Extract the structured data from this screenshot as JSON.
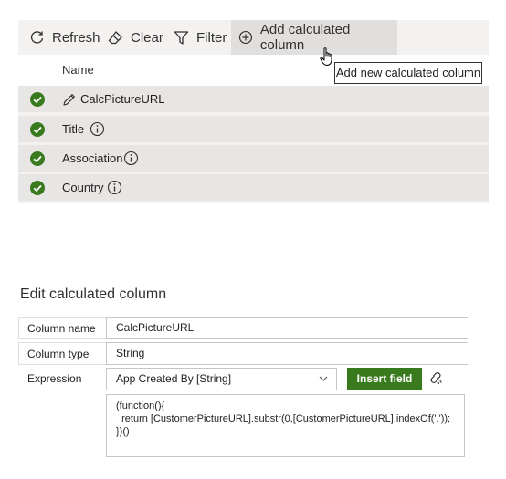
{
  "toolbar": {
    "refresh_label": "Refresh",
    "clear_label": "Clear",
    "filter_label": "Filter",
    "add_calc_label": "Add calculated column"
  },
  "tooltip": {
    "text": "Add new calculated column"
  },
  "list": {
    "header": "Name",
    "rows": [
      {
        "label": "CalcPictureURL",
        "icon": "pencil-icon",
        "info": false
      },
      {
        "label": "Title",
        "icon": "",
        "info": true
      },
      {
        "label": "Association",
        "icon": "",
        "info": true
      },
      {
        "label": "Country",
        "icon": "",
        "info": true
      }
    ]
  },
  "edit": {
    "title": "Edit calculated column",
    "column_name_label": "Column name",
    "column_name_value": "CalcPictureURL",
    "column_type_label": "Column type",
    "column_type_value": "String",
    "expression_label": "Expression",
    "expression_dropdown_value": "App Created By [String]",
    "insert_field_label": "Insert field",
    "code": "(function(){\n  return [CustomerPictureURL].substr(0,[CustomerPictureURL].indexOf(','));\n})()"
  },
  "colors": {
    "check_green": "#3a7a1f",
    "panel_bg": "#f3f2f1",
    "row_bg": "#e8e6e4",
    "insert_bg": "#3a7a1f"
  }
}
